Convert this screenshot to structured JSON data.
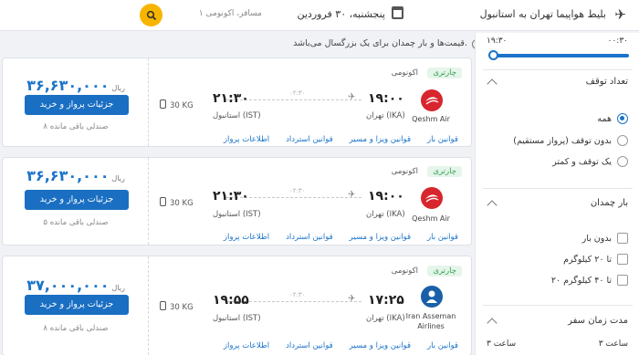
{
  "header": {
    "route": "بلیط هواپیما تهران به استانبول",
    "date": "پنجشنبه، ۳۰ فروردین",
    "passengers": "۱ مسافر، اکونومی"
  },
  "notice": "قیمت‌ها و بار چمدان برای یک بزرگسال می‌باشد.",
  "sidebar": {
    "time_from": "۰۰:۳۰",
    "time_to": "۱۹:۳۰",
    "stops_title": "تعداد توقف",
    "stops_options": [
      "همه",
      "بدون توقف (پرواز مستقیم)",
      "یک توقف و کمتر"
    ],
    "baggage_title": "بار چمدان",
    "baggage_options": [
      "بدون بار",
      "تا ۲۰ کیلوگرم",
      "۲۰ تا ۴۰ کیلوگرم"
    ],
    "duration_title": "مدت زمان سفر",
    "duration_min": "۳ ساعت",
    "duration_max": "۳ ساعت"
  },
  "flights": [
    {
      "badge": "چارتری",
      "cabin": "اکونومی",
      "airline": "Qeshm Air",
      "depart_time": "۱۹:۰۰",
      "depart_city": "تهران (IKA)",
      "arrive_time": "۲۱:۳۰",
      "arrive_city": "استانبول (IST)",
      "duration": "۰۲:۳۰",
      "baggage": "30 KG",
      "price": "۳۶,۶۳۰,۰۰۰",
      "currency": "ریال",
      "cta": "جزئیات پرواز و خرید",
      "seats": "۸ صندلی باقی مانده",
      "links": [
        "اطلاعات پرواز",
        "قوانین استرداد",
        "قوانین ویزا و مسیر",
        "قوانین بار"
      ],
      "logo_color": "#d7262e"
    },
    {
      "badge": "چارتری",
      "cabin": "اکونومی",
      "airline": "Qeshm Air",
      "depart_time": "۱۹:۰۰",
      "depart_city": "تهران (IKA)",
      "arrive_time": "۲۱:۳۰",
      "arrive_city": "استانبول (IST)",
      "duration": "۰۲:۳۰",
      "baggage": "30 KG",
      "price": "۳۶,۶۳۰,۰۰۰",
      "currency": "ریال",
      "cta": "جزئیات پرواز و خرید",
      "seats": "۵ صندلی باقی مانده",
      "links": [
        "اطلاعات پرواز",
        "قوانین استرداد",
        "قوانین ویزا و مسیر",
        "قوانین بار"
      ],
      "logo_color": "#d7262e"
    },
    {
      "badge": "چارتری",
      "cabin": "اکونومی",
      "airline": "Iran Asseman Airlines",
      "depart_time": "۱۷:۲۵",
      "depart_city": "تهران (IKA)",
      "arrive_time": "۱۹:۵۵",
      "arrive_city": "استانبول (IST)",
      "duration": "۰۲:۳۰",
      "baggage": "30 KG",
      "price": "۳۷,۰۰۰,۰۰۰",
      "currency": "ریال",
      "cta": "جزئیات پرواز و خرید",
      "seats": "۸ صندلی باقی مانده",
      "links": [
        "اطلاعات پرواز",
        "قوانین استرداد",
        "قوانین ویزا و مسیر",
        "قوانین بار"
      ],
      "logo_color": "#1a5fa8"
    }
  ]
}
